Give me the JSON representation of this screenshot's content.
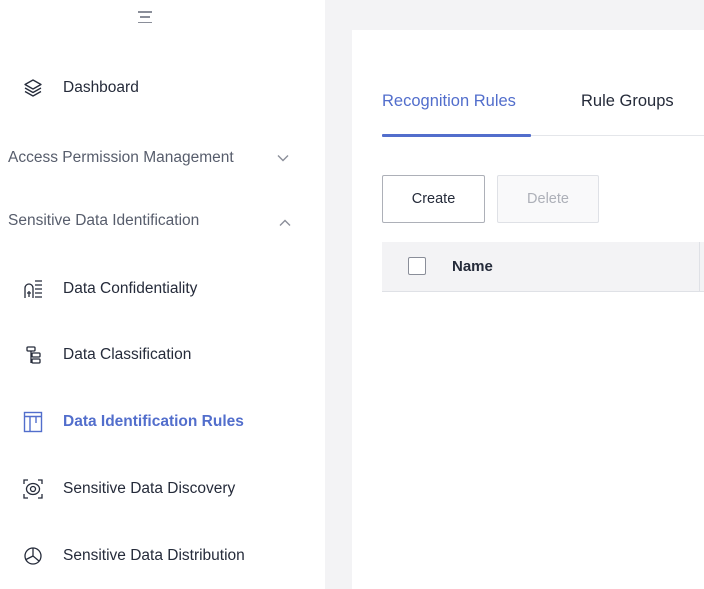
{
  "sidebar": {
    "toggle_icon": "menu-collapse-icon",
    "items": [
      {
        "label": "Dashboard",
        "icon": "layers-icon"
      },
      {
        "label": "Data Confidentiality",
        "icon": "document-grid-icon"
      },
      {
        "label": "Data Classification",
        "icon": "stacked-tag-icon"
      },
      {
        "label": "Data Identification Rules",
        "icon": "table-frame-icon"
      },
      {
        "label": "Sensitive Data Discovery",
        "icon": "scan-eye-icon"
      },
      {
        "label": "Sensitive Data Distribution",
        "icon": "pie-chart-icon"
      }
    ],
    "groups": [
      {
        "label": "Access Permission Management",
        "expanded": false,
        "icon": "chevron-down-icon"
      },
      {
        "label": "Sensitive Data Identification",
        "expanded": true,
        "icon": "chevron-up-icon"
      }
    ],
    "active_item": "Data Identification Rules"
  },
  "main": {
    "tabs": [
      {
        "label": "Recognition Rules",
        "active": true
      },
      {
        "label": "Rule Groups",
        "active": false
      }
    ],
    "buttons": {
      "create": "Create",
      "delete": "Delete"
    },
    "table": {
      "columns": [
        "Name"
      ],
      "rows": []
    }
  },
  "colors": {
    "accent": "#526ecc",
    "text": "#252b3a",
    "muted": "#575d6c",
    "background": "#f3f3f5",
    "border": "#dfe1e6"
  }
}
